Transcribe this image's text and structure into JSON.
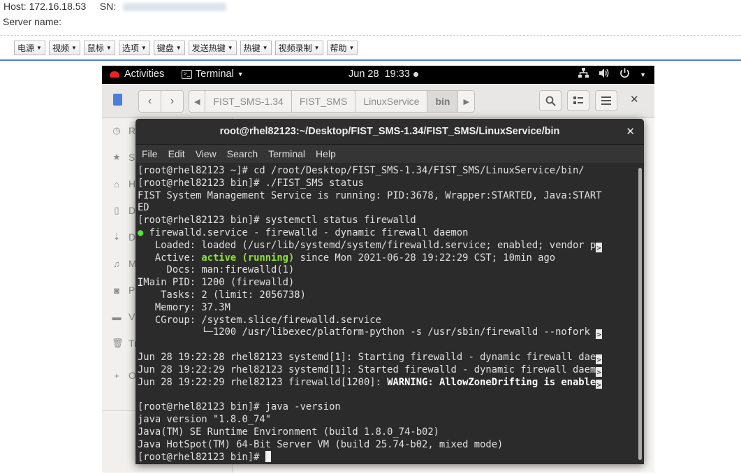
{
  "header": {
    "host_label": "Host:",
    "host_value": "172.16.18.53",
    "sn_label": "SN:",
    "server_name_label": "Server name:"
  },
  "toolbar": {
    "items": [
      "电源",
      "视频",
      "鼠标",
      "选项",
      "键盘",
      "发送热键",
      "热键",
      "视频录制",
      "帮助"
    ]
  },
  "gnome_topbar": {
    "activities": "Activities",
    "app_menu": "Terminal",
    "clock": "Jun 28  19:33"
  },
  "files_window": {
    "breadcrumbs": [
      "FIST_SMS-1.34",
      "FIST_SMS",
      "LinuxService",
      "bin"
    ],
    "sidebar_items": [
      {
        "label": "R",
        "icon": "clock-icon"
      },
      {
        "label": "S",
        "icon": "star-icon"
      },
      {
        "label": "H",
        "icon": "home-icon"
      },
      {
        "label": "D",
        "icon": "document-icon"
      },
      {
        "label": "D",
        "icon": "download-icon"
      },
      {
        "label": "M",
        "icon": "music-icon"
      },
      {
        "label": "P",
        "icon": "camera-icon"
      },
      {
        "label": "V",
        "icon": "video-icon"
      },
      {
        "label": "Tr",
        "icon": "trash-icon"
      },
      {
        "label": "O",
        "icon": "plus-icon"
      }
    ]
  },
  "terminal": {
    "title": "root@rhel82123:~/Desktop/FIST_SMS-1.34/FIST_SMS/LinuxService/bin",
    "menu": [
      "File",
      "Edit",
      "View",
      "Search",
      "Terminal",
      "Help"
    ],
    "lines": {
      "l1": "[root@rhel82123 ~]# cd /root/Desktop/FIST_SMS-1.34/FIST_SMS/LinuxService/bin/",
      "l2": "[root@rhel82123 bin]# ./FIST_SMS status",
      "l3": "FIST System Management Service is running: PID:3678, Wrapper:STARTED, Java:START",
      "l4": "ED",
      "l5": "[root@rhel82123 bin]# systemctl status firewalld",
      "l6_dot": "●",
      "l6": " firewalld.service - firewalld - dynamic firewall daemon",
      "l7": "   Loaded: loaded (/usr/lib/systemd/system/firewalld.service; enabled; vendor p",
      "l8_pre": "   Active: ",
      "l8_status": "active (running)",
      "l8_post": " since Mon 2021-06-28 19:22:29 CST; 10min ago",
      "l9": "     Docs: man:firewalld(1)",
      "l10": " Main PID: 1200 (firewalld)",
      "l11": "    Tasks: 2 (limit: 2056738)",
      "l12": "   Memory: 37.3M",
      "l13": "   CGroup: /system.slice/firewalld.service",
      "l14": "           └─1200 /usr/libexec/platform-python -s /usr/sbin/firewalld --nofork ",
      "l16": "Jun 28 19:22:28 rhel82123 systemd[1]: Starting firewalld - dynamic firewall dae",
      "l17": "Jun 28 19:22:29 rhel82123 systemd[1]: Started firewalld - dynamic firewall daem",
      "l18_pre": "Jun 28 19:22:29 rhel82123 firewalld[1200]: ",
      "l18_warn": "WARNING: AllowZoneDrifting is enable",
      "l20": "[root@rhel82123 bin]# java -version",
      "l21": "java version \"1.8.0_74\"",
      "l22": "Java(TM) SE Runtime Environment (build 1.8.0_74-b02)",
      "l23": "Java HotSpot(TM) 64-Bit Server VM (build 25.74-b02, mixed mode)",
      "l24": "[root@rhel82123 bin]# "
    },
    "truncation_marker": ">"
  },
  "colors": {
    "terminal_bg": "#2b2b2b",
    "active_green": "#8ae234",
    "accent_blue": "#4f86c6"
  }
}
